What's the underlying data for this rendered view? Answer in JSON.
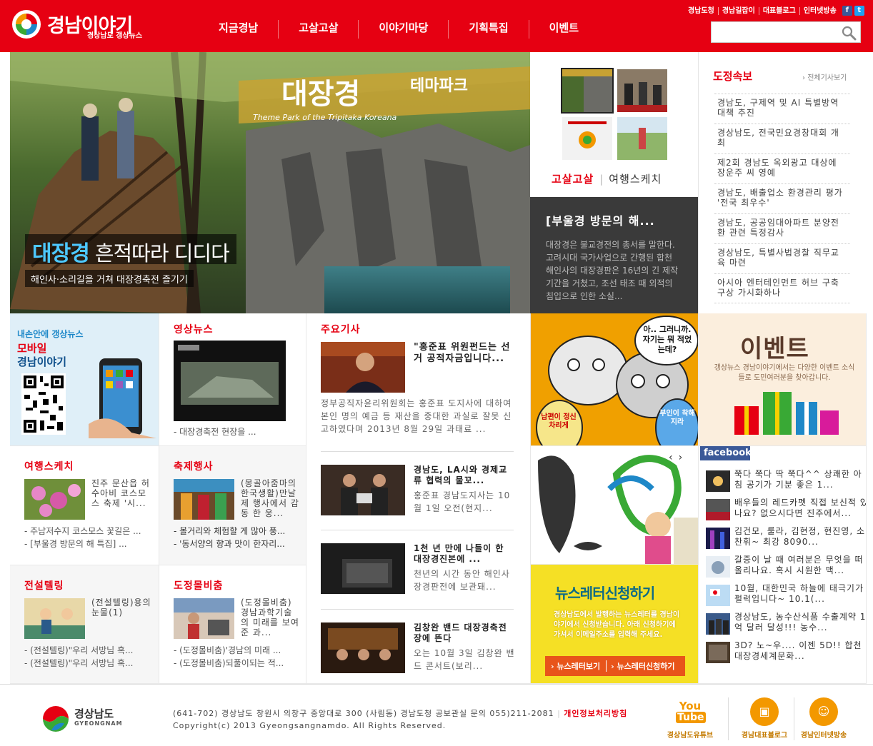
{
  "header": {
    "logo_title": "경남이야기",
    "logo_sub": "경상남도 갱상뉴스",
    "nav": [
      "지금경남",
      "고살고살",
      "이야기마당",
      "기획특집",
      "이벤트"
    ],
    "top_links": [
      "경남도청",
      "경남길잡이",
      "대표블로그",
      "인터넷방송"
    ],
    "search_placeholder": ""
  },
  "hero": {
    "banner_main": "대장경",
    "banner_side": "테마파크",
    "banner_en": "Theme Park of the Tripitaka Koreana",
    "caption_highlight": "대장경",
    "caption_rest": "흔적따라 디디다",
    "subcaption": "해인사·소리길을 거쳐 대장경축전 즐기기"
  },
  "thumbs_panel": {
    "tabs": [
      "고살고살",
      "여행스케치"
    ],
    "story_title": "[부울경 방문의 해...",
    "story_body": "대장경은 불교경전의 총서를 말한다. 고려시대 국가사업으로 간행된 합천 해인사의 대장경판은 16년의 긴 제작기간을 거쳤고, 조선 태조 때 외적의 침입으로 인한 소실..."
  },
  "briefing": {
    "title": "도정속보",
    "more": "전체기사보기",
    "items": [
      "경남도, 구제역 및 AI 특별방역대책 추진",
      "경상남도, 전국민요경창대회 개최",
      "제2회 경남도 옥외광고 대상에 장운주 씨 영예",
      "경남도, 배출업소 환경관리 평가 '전국 최우수'",
      "경남도, 공공임대아파트 분양전환 관련 특정감사",
      "경상남도, 특별사법경찰 직무교육 마련",
      "아시아 엔터테인먼트 허브 구축 구상 가시화하나"
    ]
  },
  "mobile": {
    "line1": "내손안에 갱상뉴스",
    "line2": "모바일",
    "line3": "경남이야기"
  },
  "video": {
    "title": "영상뉴스",
    "caption": "- 대장경축전 현장을 ..."
  },
  "main_news": {
    "title": "주요기사",
    "lead_title": "\"홍준표 위원펀드는 선거 공적자금입니다...",
    "lead_body": "정부공직자윤리위원회는 홍준표 도지사에 대하여 본인 명의 예금 등 재산을 중대한 과실로 잘못 신고하였다며 2013년 8월 29일 과태료 ...",
    "items": [
      {
        "title": "경남도, LA시와 경제교류 협력의 물꼬...",
        "body": "홍준표 경남도지사는 10월 1일 오전(현지..."
      },
      {
        "title": "1천 년 만에 나들이 한 대장경진본에 ...",
        "body": "천년의 시간 동안 해인사 장경판전에 보관돼..."
      },
      {
        "title": "김창완 밴드 대장경축전장에 뜬다",
        "body": "오는 10월 3일 김창완 밴드 콘서트(보리..."
      }
    ]
  },
  "cartoon": {
    "bubble": "아.. 그러니까. 자기는 뭐 적었는데?",
    "lantern1": "남편이 정신차리게",
    "lantern2": "부인이 착해지라"
  },
  "event": {
    "title": "이벤트",
    "body": "갱상뉴스 경남이야기에서는 다양한 이벤트 소식들로 도민여러분을 찾아갑니다."
  },
  "travel": {
    "title": "여행스케치",
    "item": "진주 문산읍 허수아비 코스모스 축제 '시...",
    "list": [
      "- 주남저수지 코스모스 꽃길은 ...",
      "- [부울경 방문의 해 특집] ..."
    ]
  },
  "festival": {
    "title": "축제행사",
    "item": "(몽골아줌마의 한국생활)만날 제 행사에서 감동 한 웅...",
    "list": [
      "- 볼거리와 체험할 게 많아 풍...",
      "- '동서양의 향과 맛이 한자리..."
    ]
  },
  "legend": {
    "title": "전설텔링",
    "item": "(전설텔링)용의 눈물(1)",
    "list": [
      "- (전설텔링)\"우리 서방님 혹...",
      "- (전설텔링)\"우리 서방님 혹..."
    ]
  },
  "secret": {
    "title": "도정몰비춤",
    "item": "(도정몰비춤) 경남과학기술의 미래를 보여준 과...",
    "list": [
      "- (도정몰비춤)'경남의 미래 ...",
      "- (도정몰비춤)되풀이되는 적..."
    ]
  },
  "promo": {
    "arrows": [
      "‹",
      "›"
    ]
  },
  "newsletter": {
    "title_a": "뉴스레터",
    "title_b": "신청하기",
    "body": "경상남도에서 발행하는 뉴스레터를 경남이야기에서 신청받습니다. 아래 신청하기에 가셔서 이메일주소를 입력해 주세요.",
    "btn_view": "뉴스레터보기",
    "btn_apply": "뉴스레터신청하기"
  },
  "facebook": {
    "label": "facebook",
    "items": [
      "쭉다 쭉다 딱 쭉다^^ 상쾌한 아침 공기가 기분 좋은 1...",
      "배우들의 레드카펫 직접 보신적 있나요? 없으시다면 진주에서...",
      "김건모, 룰라, 김현정, 현진영, 소찬휘~ 최강 8090...",
      "갈증이 날 때 여러분은 무엇을 떠올리나요. 혹시 시원한 맥...",
      "10월, 대한민국 하늘에 태극기가 펄럭입니다~ 10.1(...",
      "경상남도, 농수산식품 수출계약 1억 달러 달성!!! 농수...",
      "3D? 노~우.... 이젠 5D!! 합천 대장경세계문화..."
    ]
  },
  "footer": {
    "logo_ko": "경상남도",
    "logo_en": "GYEONGNAM",
    "address": "(641-702) 경상남도 창원시 의창구 중앙대로 300 (사림동) 경남도청 공보관실 문의 055)211-2081",
    "privacy": "개인정보처리방침",
    "copyright": "Copyright(c) 2013 Gyeongsangnamdo. All Rights Reserved.",
    "links": [
      "경상남도유튜브",
      "경남대표블로그",
      "경남인터넷방송"
    ],
    "youtube_a": "You",
    "youtube_b": "Tube"
  },
  "colors": {
    "brand_red": "#e60012",
    "dark_panel": "#3a3a3a",
    "newsletter_yellow": "#f5e025",
    "facebook_blue": "#3b5998"
  }
}
